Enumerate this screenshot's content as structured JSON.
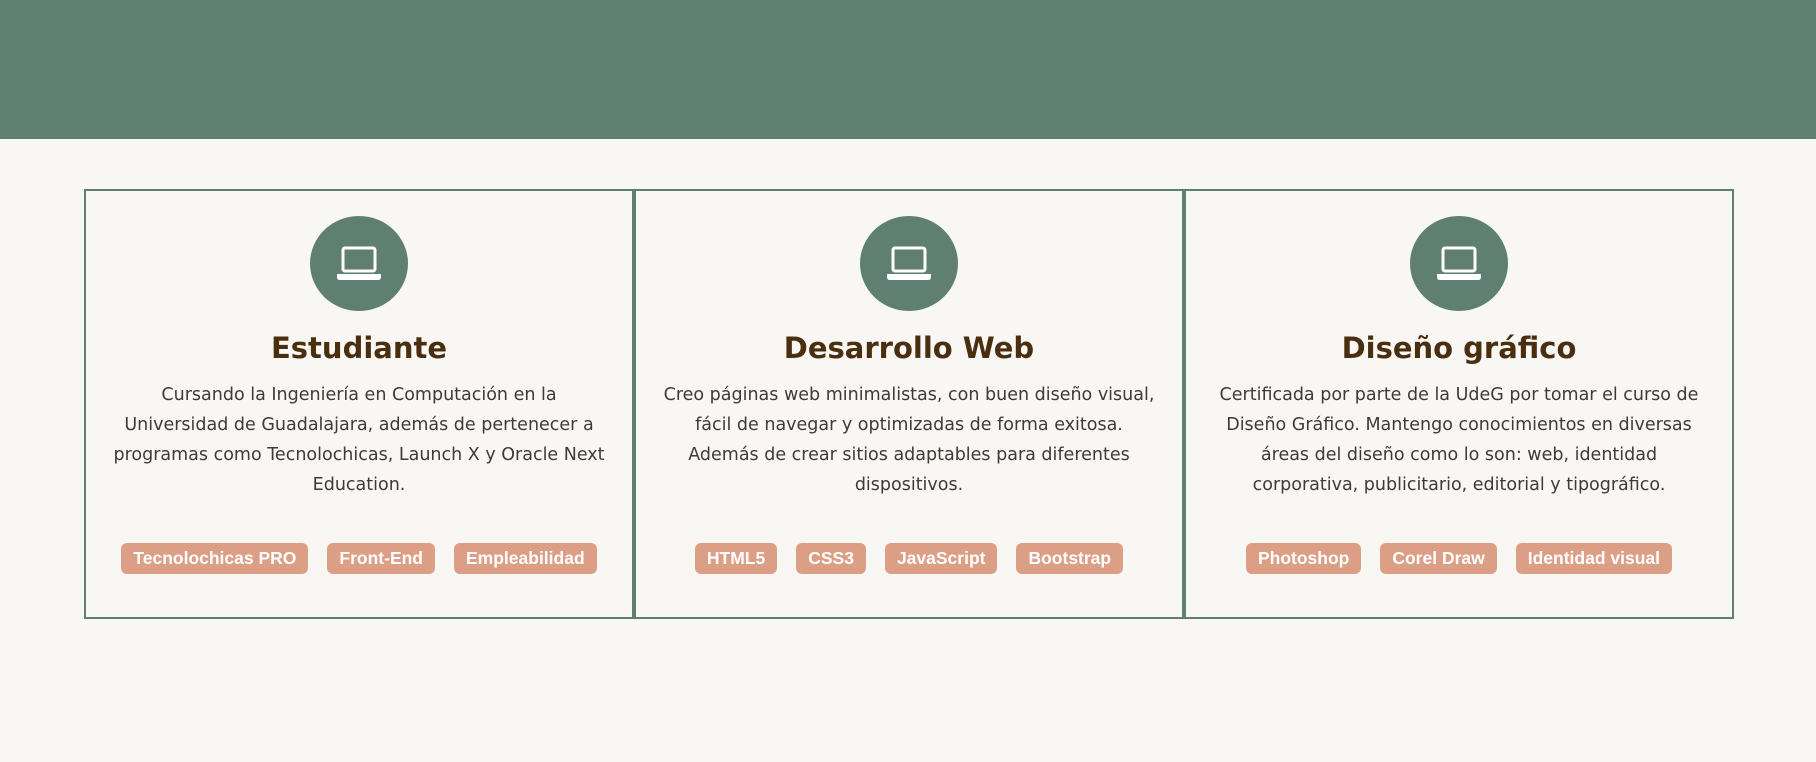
{
  "cards": [
    {
      "icon": "laptop-icon",
      "title": "Estudiante",
      "text": "Cursando la Ingeniería en Computación en la Universidad de Guadalajara, además de pertenecer a programas como Tecnolochicas, Launch X y Oracle Next Education.",
      "tags": [
        "Tecnolochicas PRO",
        "Front-End",
        "Empleabilidad"
      ]
    },
    {
      "icon": "laptop-icon",
      "title": "Desarrollo Web",
      "text": "Creo páginas web minimalistas, con buen diseño visual, fácil de navegar y optimizadas de forma exitosa. Además de crear sitios adaptables para diferentes dispositivos.",
      "tags": [
        "HTML5",
        "CSS3",
        "JavaScript",
        "Bootstrap"
      ]
    },
    {
      "icon": "laptop-icon",
      "title": "Diseño gráfico",
      "text": "Certificada por parte de la UdeG por tomar el curso de Diseño Gráfico. Mantengo conocimientos en diversas áreas del diseño como lo son: web, identidad corporativa, publicitario, editorial y tipográfico.",
      "tags": [
        "Photoshop",
        "Corel Draw",
        "Identidad visual"
      ]
    }
  ],
  "colors": {
    "band": "#5f7f72",
    "background": "#f9f7f3",
    "title": "#4a2e10",
    "tag": "#dc9f86"
  }
}
